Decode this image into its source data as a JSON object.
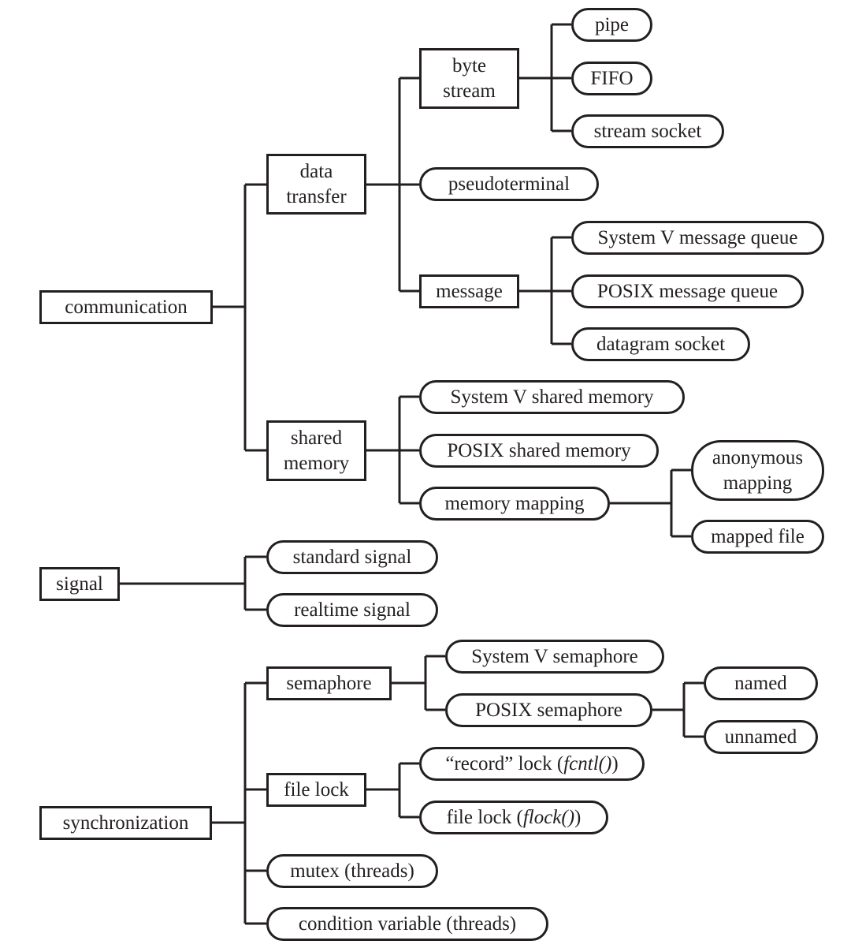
{
  "diagram": {
    "title": "",
    "nodes": {
      "communication": {
        "label": "communication",
        "shape": "rect"
      },
      "data_transfer": {
        "label": "data\ntransfer",
        "shape": "rect"
      },
      "byte_stream": {
        "label": "byte\nstream",
        "shape": "rect"
      },
      "pipe": {
        "label": "pipe",
        "shape": "pill"
      },
      "fifo": {
        "label": "FIFO",
        "shape": "pill"
      },
      "stream_socket": {
        "label": "stream socket",
        "shape": "pill"
      },
      "pseudoterminal": {
        "label": "pseudoterminal",
        "shape": "pill"
      },
      "message": {
        "label": "message",
        "shape": "rect"
      },
      "sysv_msgq": {
        "label": "System V message queue",
        "shape": "pill"
      },
      "posix_msgq": {
        "label": "POSIX message queue",
        "shape": "pill"
      },
      "datagram_socket": {
        "label": "datagram socket",
        "shape": "pill"
      },
      "shared_memory": {
        "label": "shared\nmemory",
        "shape": "rect"
      },
      "sysv_shm": {
        "label": "System V shared memory",
        "shape": "pill"
      },
      "posix_shm": {
        "label": "POSIX shared memory",
        "shape": "pill"
      },
      "memory_mapping": {
        "label": "memory mapping",
        "shape": "pill"
      },
      "anonymous_mapping": {
        "label": "anonymous\nmapping",
        "shape": "pill"
      },
      "mapped_file": {
        "label": "mapped file",
        "shape": "pill"
      },
      "signal": {
        "label": "signal",
        "shape": "rect"
      },
      "standard_signal": {
        "label": "standard signal",
        "shape": "pill"
      },
      "realtime_signal": {
        "label": "realtime signal",
        "shape": "pill"
      },
      "synchronization": {
        "label": "synchronization",
        "shape": "rect"
      },
      "semaphore": {
        "label": "semaphore",
        "shape": "rect"
      },
      "sysv_sem": {
        "label": "System V semaphore",
        "shape": "pill"
      },
      "posix_sem": {
        "label": "POSIX semaphore",
        "shape": "pill"
      },
      "named": {
        "label": "named",
        "shape": "pill"
      },
      "unnamed": {
        "label": "unnamed",
        "shape": "pill"
      },
      "file_lock": {
        "label": "file lock",
        "shape": "rect"
      },
      "record_lock": {
        "label_prefix": "“record” lock (",
        "label_italic": "fcntl()",
        "label_suffix": ")",
        "shape": "pill"
      },
      "flock": {
        "label_prefix": "file lock (",
        "label_italic": "flock()",
        "label_suffix": ")",
        "shape": "pill"
      },
      "mutex": {
        "label": "mutex (threads)",
        "shape": "pill"
      },
      "condition_variable": {
        "label": "condition variable (threads)",
        "shape": "pill"
      }
    },
    "edges": [
      [
        "communication",
        "data_transfer"
      ],
      [
        "communication",
        "shared_memory"
      ],
      [
        "data_transfer",
        "byte_stream"
      ],
      [
        "data_transfer",
        "pseudoterminal"
      ],
      [
        "data_transfer",
        "message"
      ],
      [
        "byte_stream",
        "pipe"
      ],
      [
        "byte_stream",
        "fifo"
      ],
      [
        "byte_stream",
        "stream_socket"
      ],
      [
        "message",
        "sysv_msgq"
      ],
      [
        "message",
        "posix_msgq"
      ],
      [
        "message",
        "datagram_socket"
      ],
      [
        "shared_memory",
        "sysv_shm"
      ],
      [
        "shared_memory",
        "posix_shm"
      ],
      [
        "shared_memory",
        "memory_mapping"
      ],
      [
        "memory_mapping",
        "anonymous_mapping"
      ],
      [
        "memory_mapping",
        "mapped_file"
      ],
      [
        "signal",
        "standard_signal"
      ],
      [
        "signal",
        "realtime_signal"
      ],
      [
        "synchronization",
        "semaphore"
      ],
      [
        "synchronization",
        "file_lock"
      ],
      [
        "synchronization",
        "mutex"
      ],
      [
        "synchronization",
        "condition_variable"
      ],
      [
        "semaphore",
        "sysv_sem"
      ],
      [
        "semaphore",
        "posix_sem"
      ],
      [
        "posix_sem",
        "named"
      ],
      [
        "posix_sem",
        "unnamed"
      ],
      [
        "file_lock",
        "record_lock"
      ],
      [
        "file_lock",
        "flock"
      ]
    ]
  }
}
